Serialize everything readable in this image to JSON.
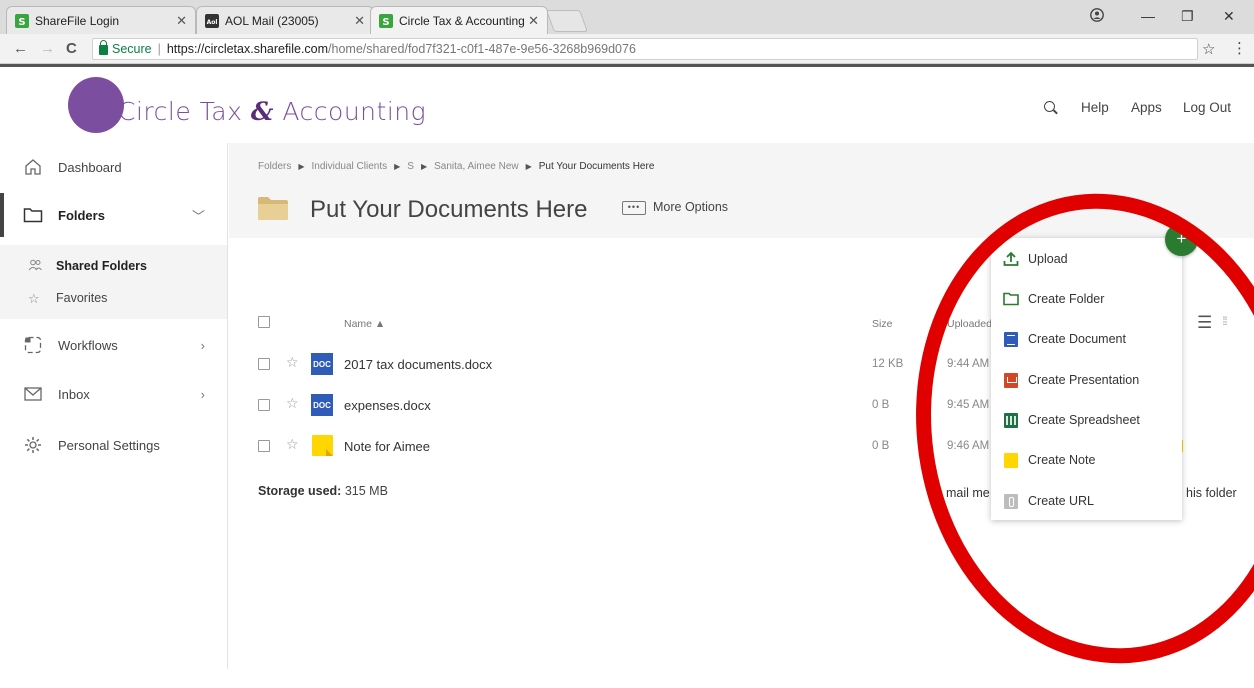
{
  "browser": {
    "tabs": [
      {
        "title": "ShareFile Login"
      },
      {
        "title": "AOL Mail (23005)"
      },
      {
        "title": "Circle Tax & Accounting"
      }
    ],
    "secure_label": "Secure",
    "url_scheme_host": "https://circletax.sharefile.com",
    "url_path": "/home/shared/fod7f321-c0f1-487e-9e56-3268b969d076",
    "accent_color": "#0b8043"
  },
  "header": {
    "logo_main": "Circle Tax",
    "logo_amp": "&",
    "logo_tail": "Accounting",
    "nav": {
      "help": "Help",
      "apps": "Apps",
      "logout": "Log Out"
    },
    "brand_color": "#7b4ea0"
  },
  "sidebar": {
    "dashboard": "Dashboard",
    "folders": "Folders",
    "shared_folders": "Shared Folders",
    "favorites": "Favorites",
    "workflows": "Workflows",
    "inbox": "Inbox",
    "personal_settings": "Personal Settings"
  },
  "breadcrumb": [
    "Folders",
    "Individual Clients",
    "S",
    "Sanita, Aimee New",
    "Put Your Documents Here"
  ],
  "folder": {
    "title": "Put Your Documents Here",
    "more_options": "More Options"
  },
  "table": {
    "headers": {
      "name": "Name ▲",
      "size": "Size",
      "uploaded": "Uploaded"
    },
    "rows": [
      {
        "name": "2017 tax documents.docx",
        "size": "12 KB",
        "uploaded": "9:44 AM",
        "icon": "doc-icon",
        "icon_label": "DOC"
      },
      {
        "name": "expenses.docx",
        "size": "0 B",
        "uploaded": "9:45 AM",
        "icon": "doc-icon",
        "icon_label": "DOC"
      },
      {
        "name": "Note for Aimee",
        "size": "0 B",
        "uploaded": "9:46 AM",
        "icon": "note-icon"
      }
    ]
  },
  "footer": {
    "storage_label": "Storage used:",
    "storage_value": "315 MB",
    "email_fragment": "mail me",
    "folder_fragment": "his folder"
  },
  "add_menu": {
    "button_color": "#2a7a2f",
    "items": [
      {
        "label": "Upload",
        "icon": "upload-icon"
      },
      {
        "label": "Create Folder",
        "icon": "folder-outline-icon"
      },
      {
        "label": "Create Document",
        "icon": "document-icon"
      },
      {
        "label": "Create Presentation",
        "icon": "presentation-icon"
      },
      {
        "label": "Create Spreadsheet",
        "icon": "spreadsheet-icon"
      },
      {
        "label": "Create Note",
        "icon": "note-icon"
      },
      {
        "label": "Create URL",
        "icon": "url-icon"
      }
    ]
  },
  "annotation_color": "#e00000"
}
